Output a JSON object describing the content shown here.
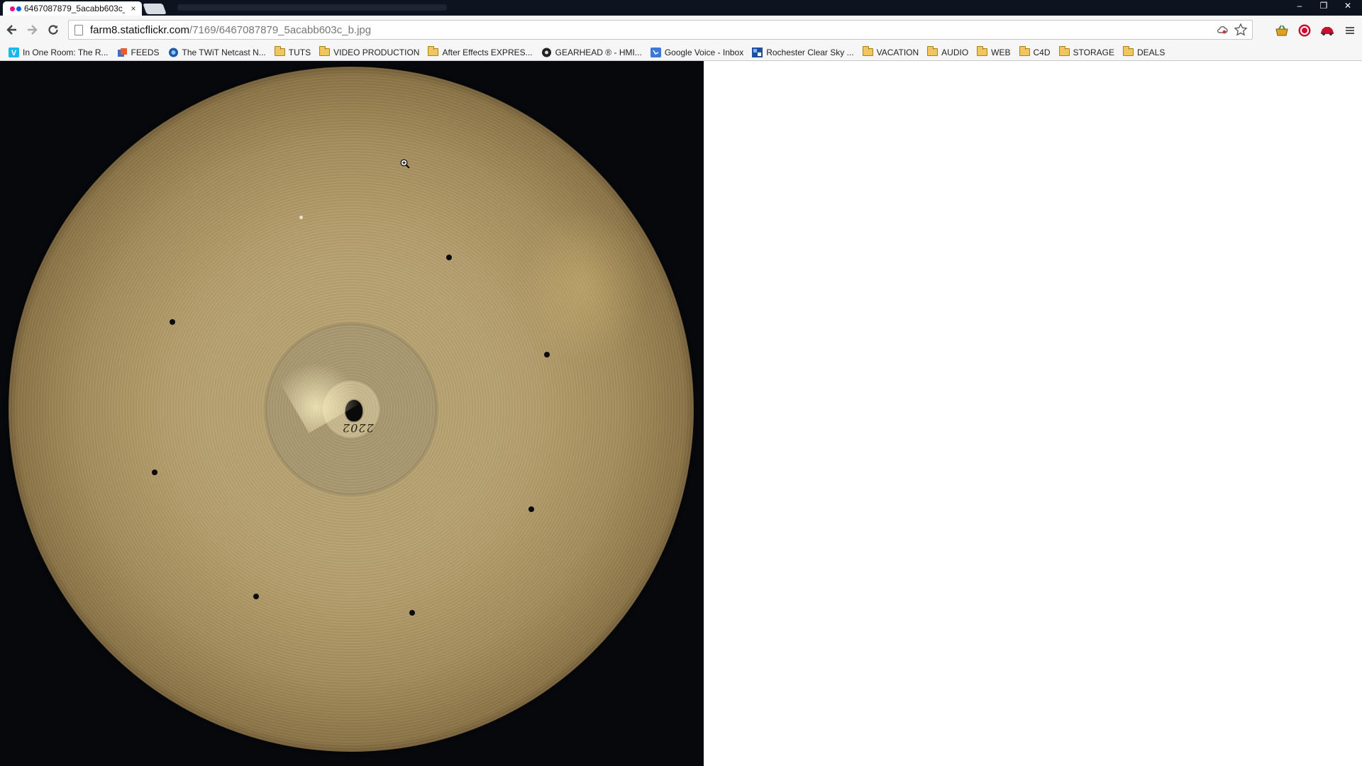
{
  "browser": {
    "tab": {
      "title": "6467087879_5acabb603c_b",
      "close_glyph": "×",
      "favicon_colors": [
        "#ff0084",
        "#0063dc"
      ]
    },
    "window_controls": {
      "minimize": "–",
      "restore": "❐",
      "close": "✕"
    },
    "address": {
      "host": "farm8.staticflickr.com",
      "path": "/7169/6467087879_5acabb603c_b.jpg"
    }
  },
  "bookmarks": [
    {
      "label": "In One Room: The R...",
      "icon": "vimeo-icon"
    },
    {
      "label": "FEEDS",
      "icon": "feed-icon"
    },
    {
      "label": "The TWiT Netcast N...",
      "icon": "twit-icon"
    },
    {
      "label": "TUTS",
      "icon": "folder-icon"
    },
    {
      "label": "VIDEO PRODUCTION",
      "icon": "folder-icon"
    },
    {
      "label": "After Effects EXPRES...",
      "icon": "folder-icon"
    },
    {
      "label": "GEARHEAD ® - HMI...",
      "icon": "gearhead-icon"
    },
    {
      "label": "Google Voice - Inbox",
      "icon": "google-voice-icon"
    },
    {
      "label": "Rochester Clear Sky ...",
      "icon": "clear-sky-icon"
    },
    {
      "label": "VACATION",
      "icon": "folder-icon"
    },
    {
      "label": "AUDIO",
      "icon": "folder-icon"
    },
    {
      "label": "WEB",
      "icon": "folder-icon"
    },
    {
      "label": "C4D",
      "icon": "folder-icon"
    },
    {
      "label": "STORAGE",
      "icon": "folder-icon"
    },
    {
      "label": "DEALS",
      "icon": "folder-icon"
    }
  ],
  "photo": {
    "stamp": "2202"
  }
}
